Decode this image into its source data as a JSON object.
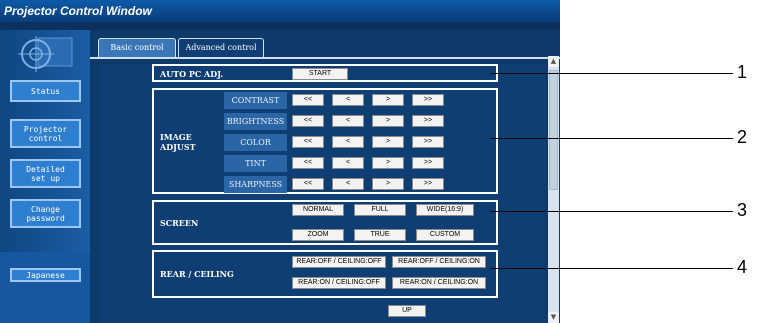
{
  "window": {
    "title": "Projector Control Window"
  },
  "sidebar": {
    "buttons": [
      {
        "label": "Status"
      },
      {
        "label": "Projector\ncontrol"
      },
      {
        "label": "Detailed\nset up"
      },
      {
        "label": "Change\npassword"
      }
    ],
    "language_button": "Japanese"
  },
  "tabs": [
    {
      "label": "Basic control"
    },
    {
      "label": "Advanced control"
    }
  ],
  "auto_pc": {
    "label": "AUTO PC ADJ.",
    "start": "START"
  },
  "image_adjust": {
    "label": "IMAGE\nADJUST",
    "rows": [
      {
        "label": "CONTRAST"
      },
      {
        "label": "BRIGHTNESS"
      },
      {
        "label": "COLOR"
      },
      {
        "label": "TINT"
      },
      {
        "label": "SHARPNESS"
      }
    ],
    "buttons": [
      "<<",
      "<",
      ">",
      ">>"
    ]
  },
  "screen": {
    "label": "SCREEN",
    "options_top": [
      "NORMAL",
      "FULL",
      "WIDE(16:9)"
    ],
    "options_bottom": [
      "ZOOM",
      "TRUE",
      "CUSTOM"
    ]
  },
  "rear_ceiling": {
    "label": "REAR / CEILING",
    "options": [
      "REAR:OFF / CEILING:OFF",
      "REAR:OFF / CEILING:ON",
      "REAR:ON / CEILING:OFF",
      "REAR:ON / CEILING:ON"
    ]
  },
  "partial_button": "UP",
  "callouts": [
    "1",
    "2",
    "3",
    "4"
  ],
  "colors": {
    "background": "#0f3e74",
    "sidebar_button": "#2f7fd0",
    "row_label": "#2a65a6"
  }
}
